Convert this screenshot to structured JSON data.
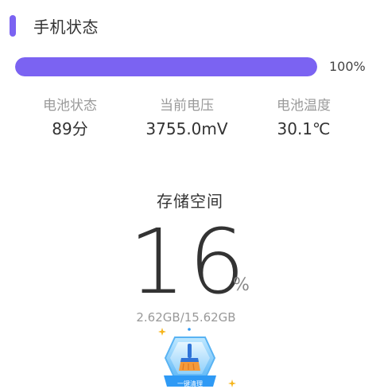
{
  "header": {
    "title": "手机状态"
  },
  "battery": {
    "level_fraction": 1.0,
    "percent_label": "100%"
  },
  "stats": [
    {
      "label": "电池状态",
      "value": "89分"
    },
    {
      "label": "当前电压",
      "value": "3755.0mV"
    },
    {
      "label": "电池温度",
      "value": "30.1℃"
    }
  ],
  "storage": {
    "title": "存储空间",
    "percent": "16",
    "unit": "%",
    "size_text": "2.62GB/15.62GB"
  },
  "clean": {
    "label": "一键清理",
    "icon": "broom-icon"
  },
  "colors": {
    "accent": "#7b63f2",
    "clean_blue": "#2f9af5",
    "sparkle": "#f6b51c"
  }
}
